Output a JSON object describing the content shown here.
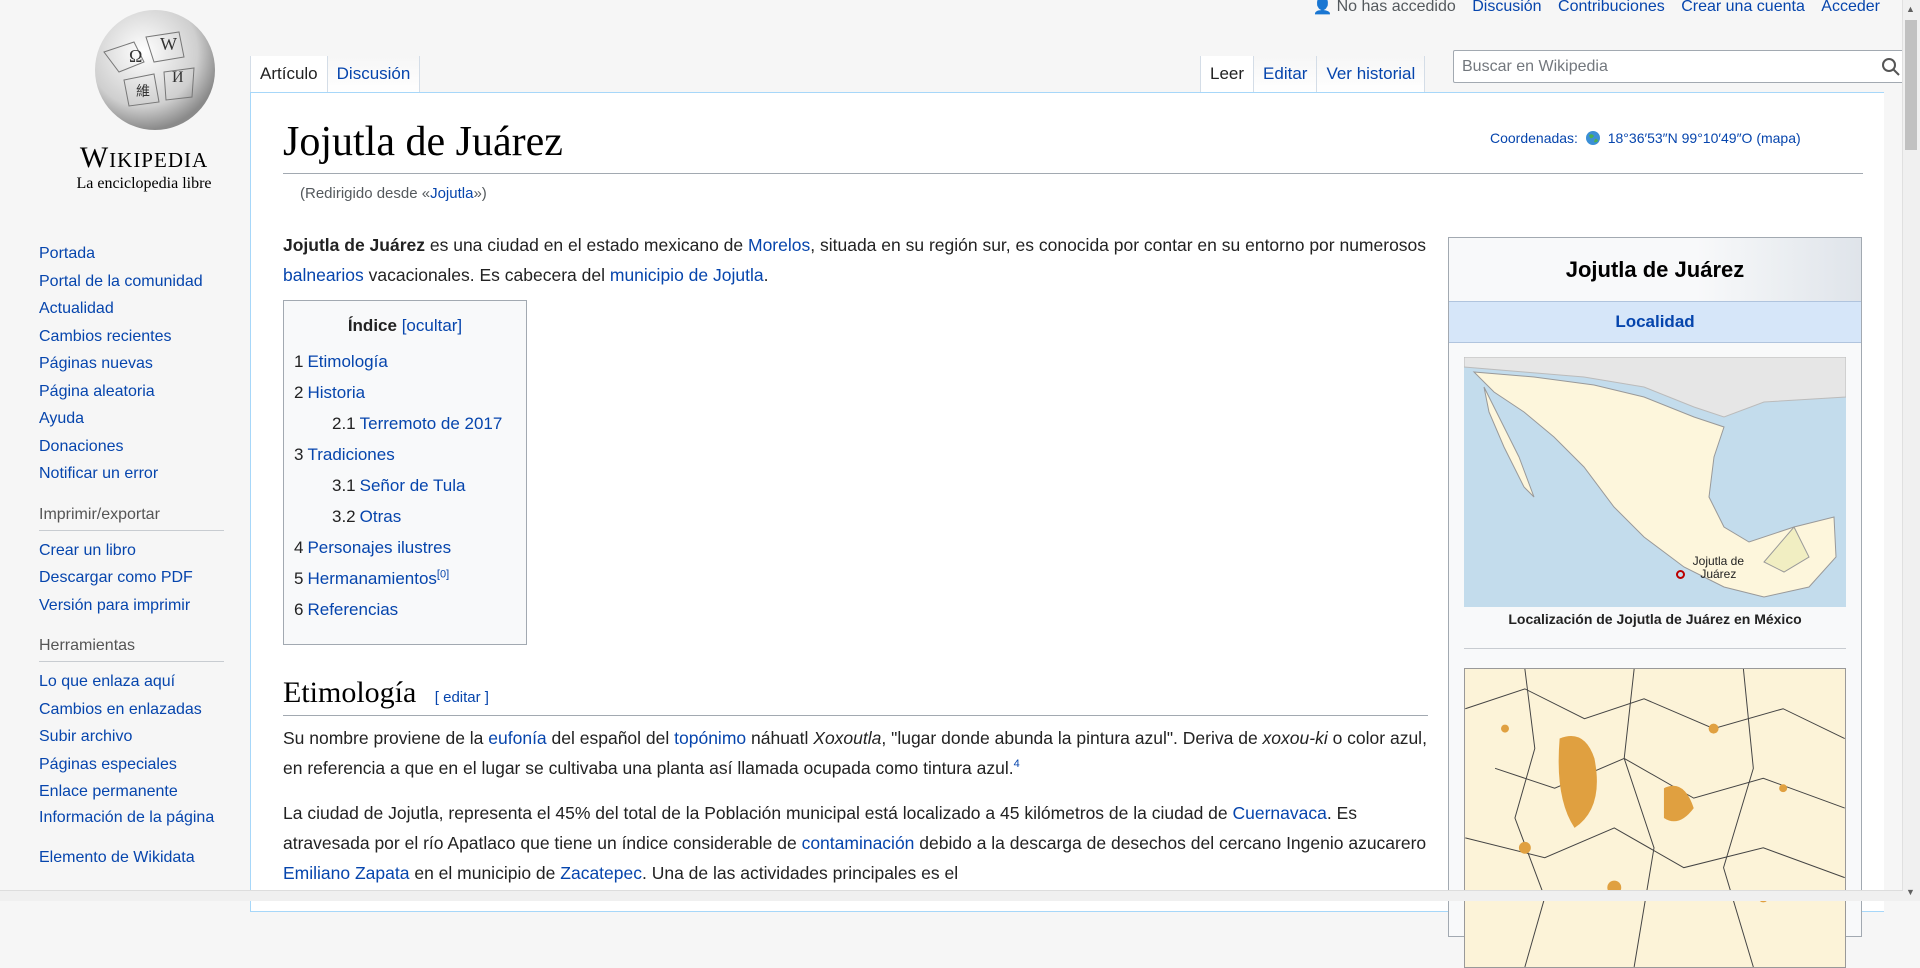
{
  "personal": {
    "user_status": "No has accedido",
    "links": [
      "Discusión",
      "Contribuciones",
      "Crear una cuenta",
      "Acceder"
    ]
  },
  "logo": {
    "wordmark": "Wikipedia",
    "tagline": "La enciclopedia libre"
  },
  "sidebar": {
    "nav": [
      "Portada",
      "Portal de la comunidad",
      "Actualidad",
      "Cambios recientes",
      "Páginas nuevas",
      "Página aleatoria",
      "Ayuda",
      "Donaciones",
      "Notificar un error"
    ],
    "print_heading": "Imprimir/exportar",
    "print": [
      "Crear un libro",
      "Descargar como PDF",
      "Versión para imprimir"
    ],
    "tools_heading": "Herramientas",
    "tools": [
      "Lo que enlaza aquí",
      "Cambios en enlazadas",
      "Subir archivo",
      "Páginas especiales",
      "Enlace permanente",
      "Información de la página",
      "Elemento de Wikidata"
    ]
  },
  "tabs": {
    "left": [
      "Artículo",
      "Discusión"
    ],
    "right": [
      "Leer",
      "Editar",
      "Ver historial"
    ]
  },
  "search": {
    "placeholder": "Buscar en Wikipedia"
  },
  "article": {
    "title": "Jojutla de Juárez",
    "coords_label": "Coordenadas:",
    "coords_value": "18°36′53″N 99°10′49″O",
    "coords_map": "(mapa)",
    "redirect_prefix": "(Redirigido desde «",
    "redirect_link": "Jojutla",
    "redirect_suffix": "»)",
    "intro": {
      "bold": "Jojutla de Juárez",
      "t1": " es una ciudad en el estado mexicano de ",
      "l1": "Morelos",
      "t2": ", situada en su región sur, es conocida por contar en su entorno por numerosos ",
      "l2": "balnearios",
      "t3": " vacacionales. Es cabecera del ",
      "l3": "municipio de Jojutla",
      "t4": "."
    },
    "toc": {
      "title": "Índice",
      "toggle": "[ocultar]",
      "items": [
        {
          "num": "1",
          "label": "Etimología",
          "sub": false
        },
        {
          "num": "2",
          "label": "Historia",
          "sub": false
        },
        {
          "num": "2.1",
          "label": "Terremoto de 2017",
          "sub": true
        },
        {
          "num": "3",
          "label": "Tradiciones",
          "sub": false
        },
        {
          "num": "3.1",
          "label": "Señor de Tula",
          "sub": true
        },
        {
          "num": "3.2",
          "label": "Otras",
          "sub": true
        },
        {
          "num": "4",
          "label": "Personajes ilustres",
          "sub": false
        },
        {
          "num": "5",
          "label": "Hermanamientos",
          "sub": false,
          "sup": "[0]"
        },
        {
          "num": "6",
          "label": "Referencias",
          "sub": false
        }
      ]
    },
    "section1": {
      "heading": "Etimología",
      "edit": "[ editar ]",
      "p1": {
        "t1": "Su nombre proviene de la ",
        "l1": "eufonía",
        "t2": " del español del ",
        "l2": "topónimo",
        "t3": " náhuatl ",
        "i1": "Xoxoutla",
        "t4": ", \"lugar donde abunda la pintura azul\". Deriva de ",
        "i2": "xoxou-ki",
        "t5": " o color azul, en referencia a que en el lugar se cultivaba una planta así llamada ocupada como tintura azul.",
        "ref": "4"
      },
      "p2": {
        "t1": "La ciudad de Jojutla, representa el 45% del total de la Población municipal está localizado a 45 kilómetros de la ciudad de ",
        "l1": "Cuernavaca",
        "t2": ". Es atravesada por el río Apatlaco que tiene un índice considerable de ",
        "l2": "contaminación",
        "t3": " debido a la descarga de desechos del cercano Ingenio azucarero ",
        "l3": "Emiliano Zapata",
        "t4": " en el municipio de ",
        "l4": "Zacatepec",
        "t5": ". Una de las actividades principales es el"
      }
    }
  },
  "infobox": {
    "title": "Jojutla de Juárez",
    "subtitle": "Localidad",
    "map_label": "Jojutla de Juárez",
    "caption": "Localización de Jojutla de Juárez en México"
  },
  "colors": {
    "link": "#0645ad",
    "infobox_header": "#d6e6f9",
    "border": "#a7d7f9"
  },
  "icons": [
    "globe-logo-icon",
    "user-icon",
    "search-icon",
    "globe-coord-icon",
    "map-marker-icon"
  ]
}
